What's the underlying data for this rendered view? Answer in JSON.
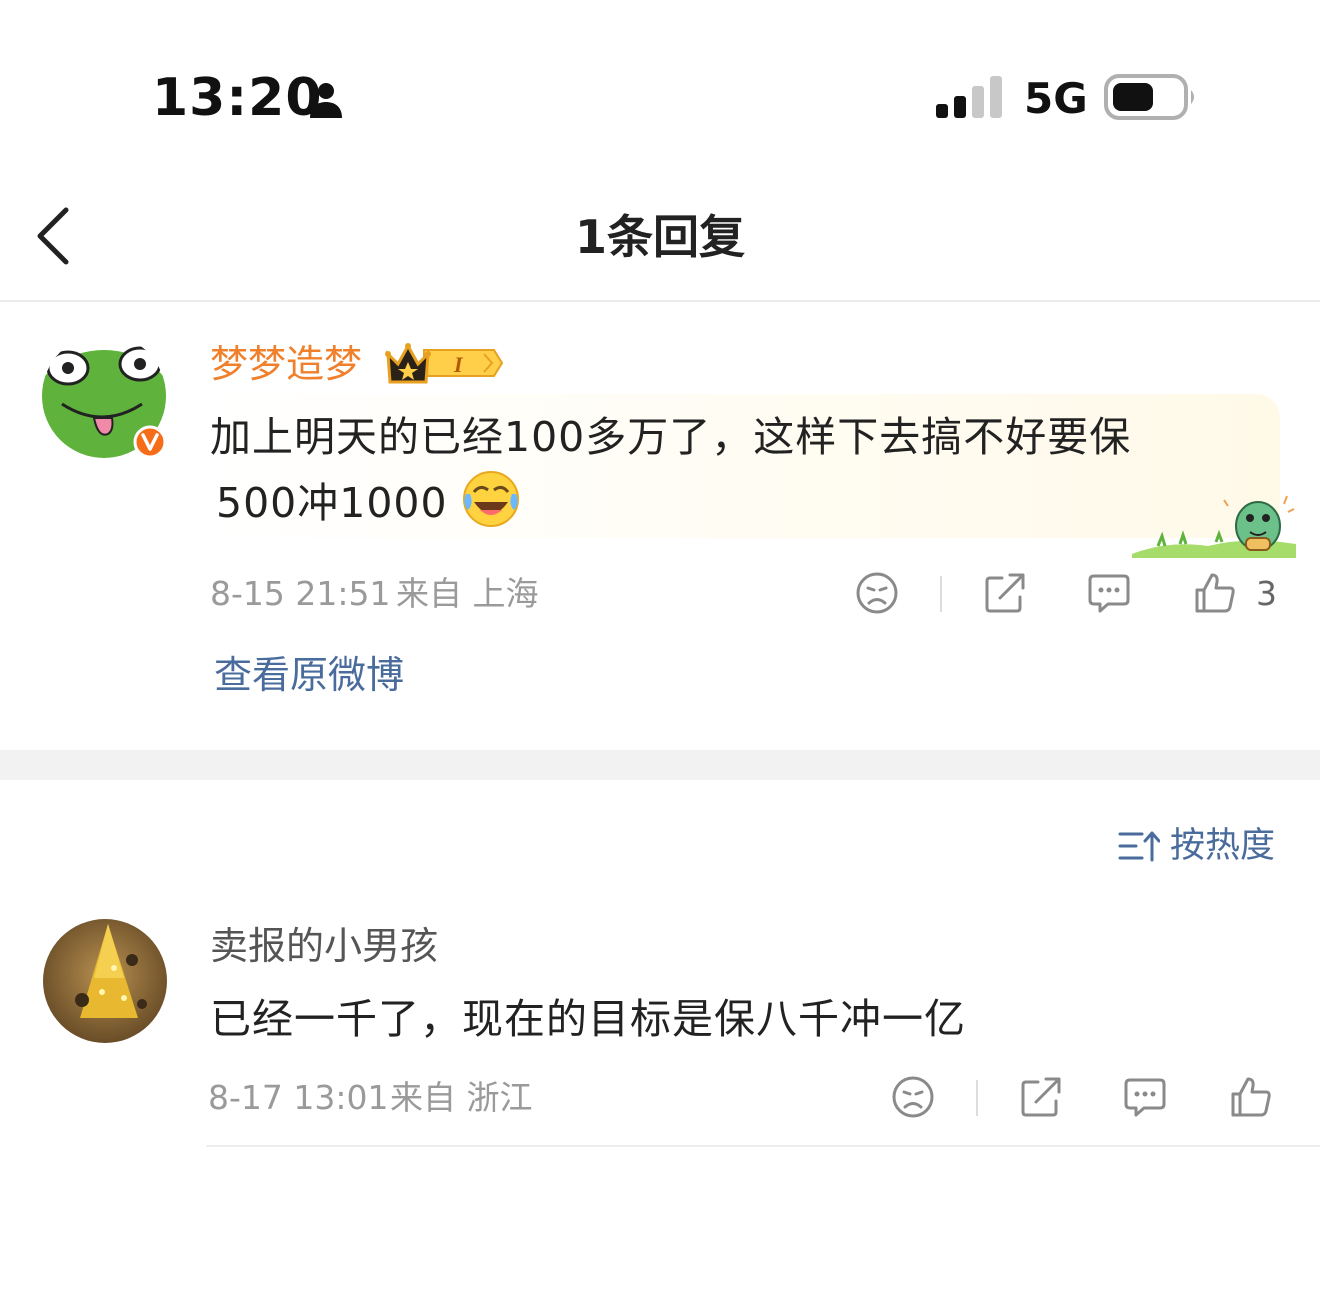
{
  "status_bar": {
    "time": "13:20",
    "network": "5G"
  },
  "header": {
    "title": "1条回复"
  },
  "original_post": {
    "username": "梦梦造梦",
    "badge_text": "I",
    "text_line1": "加上明天的已经100多万了，这样下去搞不好要保",
    "text_line2": "500冲1000",
    "date": "8-15 21:51",
    "location": "来自 上海",
    "like_count": "3",
    "view_original": "查看原微博"
  },
  "sort": {
    "label": "按热度"
  },
  "reply": {
    "username": "卖报的小男孩",
    "text": "已经一千了，现在的目标是保八千冲一亿",
    "date": "8-17 13:01",
    "location": "来自 浙江"
  },
  "colors": {
    "username_orange": "#f0802b",
    "link_blue": "#4a6c9c",
    "meta_gray": "#9a9a9a",
    "verified_orange": "#f56d18"
  }
}
